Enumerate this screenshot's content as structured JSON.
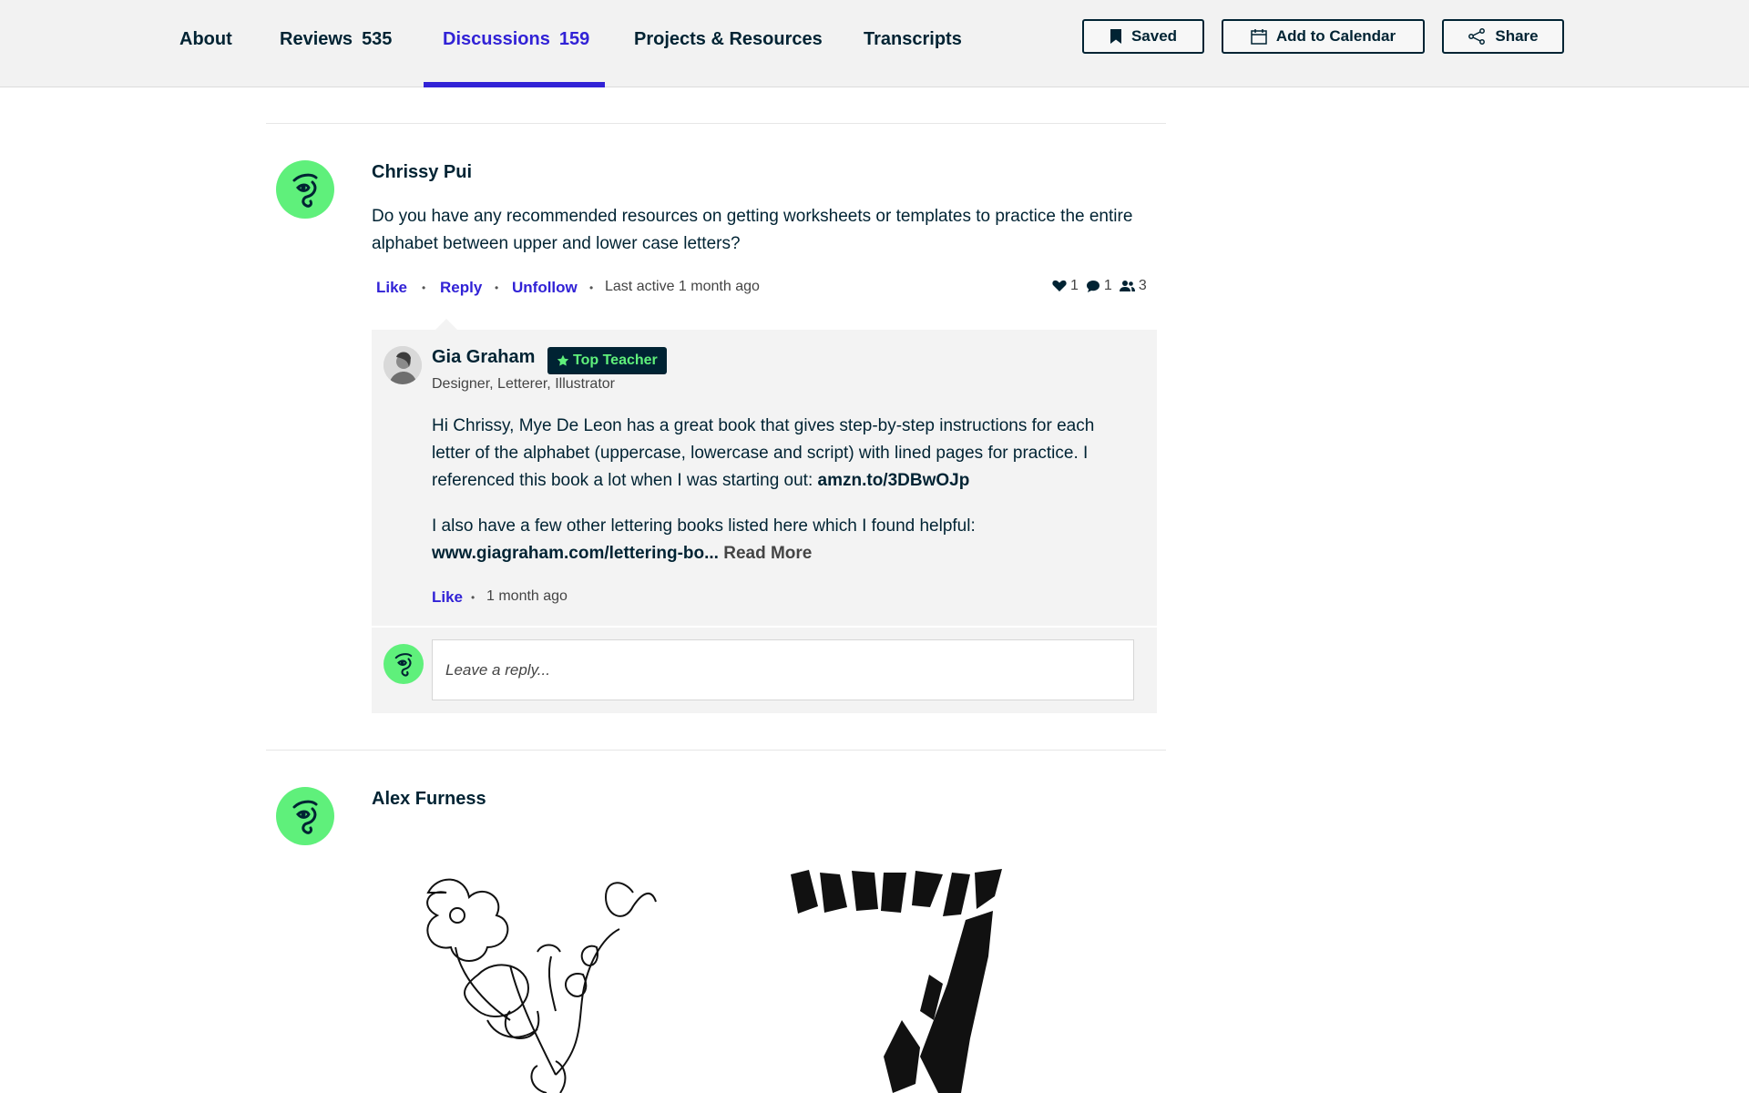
{
  "nav": {
    "tabs": [
      {
        "label": "About"
      },
      {
        "label": "Reviews",
        "count": "535"
      },
      {
        "label": "Discussions",
        "count": "159"
      },
      {
        "label": "Projects & Resources"
      },
      {
        "label": "Transcripts"
      }
    ],
    "active_tab": "Discussions",
    "buttons": {
      "saved": "Saved",
      "calendar": "Add to Calendar",
      "share": "Share"
    }
  },
  "discussion1": {
    "author": "Chrissy Pui",
    "text": "Do you have any recommended resources on getting worksheets or templates to practice the entire alphabet between upper and lower case letters?",
    "actions": {
      "like": "Like",
      "reply": "Reply",
      "unfollow": "Unfollow"
    },
    "last_active": "Last active 1 month ago",
    "stats": {
      "likes": "1",
      "comments": "1",
      "followers": "3"
    },
    "reply": {
      "author": "Gia Graham",
      "badge": "Top Teacher",
      "role": "Designer, Letterer, Illustrator",
      "p1_text": "Hi Chrissy, Mye De Leon has a great book that gives step-by-step instructions for each letter of the alphabet (uppercase, lowercase and script) with lined pages for practice. I referenced this book a lot when I was starting out: ",
      "p1_link": "amzn.to/3DBwOJp",
      "p2_text": "I also have a few other lettering books listed here which I found helpful: ",
      "p2_link": "www.giagraham.com/lettering-bo...",
      "read_more": "Read More",
      "like": "Like",
      "time": "1 month ago"
    },
    "reply_placeholder": "Leave a reply..."
  },
  "discussion2": {
    "author": "Alex Furness"
  },
  "colors": {
    "accent": "#3122d6",
    "navy": "#002333",
    "brand_green": "#5ff07b"
  }
}
